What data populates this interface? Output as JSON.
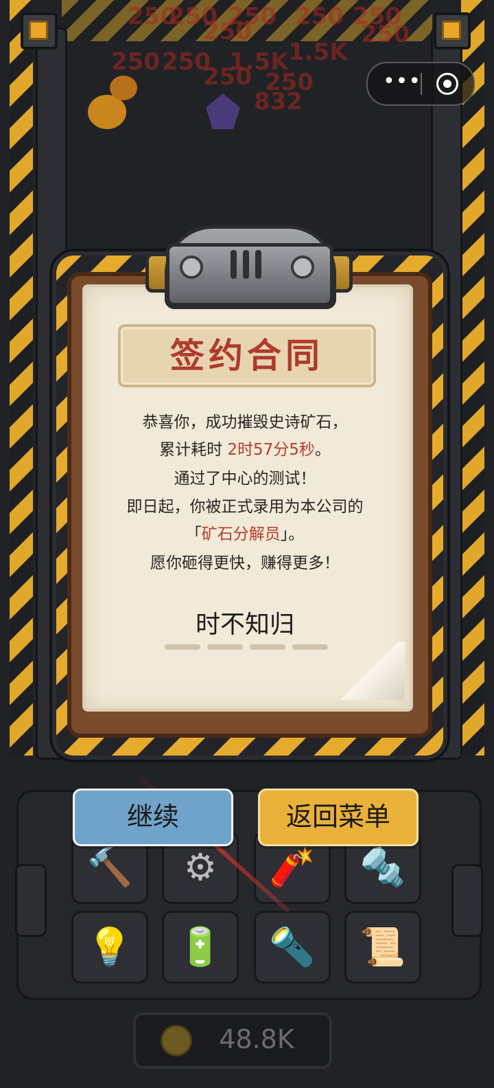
{
  "scene": {
    "floating_numbers": [
      "250",
      "250",
      "250",
      "250",
      "250",
      "250",
      "250",
      "250",
      "250",
      "250",
      "1.5K",
      "1.5K",
      "250",
      "832"
    ]
  },
  "capsule": {
    "more_icon": "more-dots-icon",
    "close_icon": "target-close-icon"
  },
  "dialog": {
    "title": "签约合同",
    "line1": "恭喜你，成功摧毁史诗矿石，",
    "line2_prefix": "累计耗时 ",
    "line2_time": "2时57分5秒",
    "line2_suffix": "。",
    "line3": "通过了中心的测试！",
    "line4": "即日起，你被正式录用为本公司的",
    "line5_open": "「",
    "line5_role": "矿石分解员",
    "line5_close": "」。",
    "line6": "愿你砸得更快，赚得更多！",
    "signature": "时不知归"
  },
  "buttons": {
    "continue": "继续",
    "menu": "返回菜单"
  },
  "inventory": {
    "items": [
      "hammer-icon",
      "gear-icon",
      "dynamite-icon",
      "drill-icon",
      "lightbulb-icon",
      "battery-icon",
      "laser-gun-icon",
      "blueprint-icon"
    ]
  },
  "currency": {
    "amount": "48.8K",
    "icon": "coin-icon"
  },
  "colors": {
    "accent_red": "#b03a2e",
    "hazard_yellow": "#e6aa2c",
    "continue_blue": "#70a3c9",
    "menu_orange": "#eab13a"
  }
}
